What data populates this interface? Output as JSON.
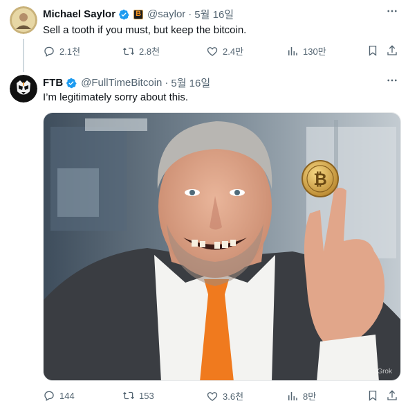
{
  "tweet1": {
    "author_name": "Michael Saylor",
    "affiliate_badge": "B",
    "handle": "@saylor",
    "separator": "·",
    "date": "5월 16일",
    "text": "Sell a tooth if you must, but keep the bitcoin.",
    "replies": "2.1천",
    "retweets": "2.8천",
    "likes": "2.4만",
    "views": "130만"
  },
  "tweet2": {
    "author_name": "FTB",
    "handle": "@FullTimeBitcoin",
    "separator": "·",
    "date": "5월 16일",
    "text": "I’m legitimately sorry about this.",
    "image_watermark": "Grok",
    "replies": "144",
    "retweets": "153",
    "likes": "3.6천",
    "views": "8만"
  },
  "icons": {
    "more": "more-icon",
    "reply": "reply-icon",
    "retweet": "retweet-icon",
    "like": "heart-icon",
    "views": "views-icon",
    "bookmark": "bookmark-icon",
    "share": "share-icon",
    "verified": "verified-badge-icon"
  },
  "colors": {
    "verified_blue": "#1d9bf0",
    "muted_text": "#536471",
    "bitcoin_orange": "#f7931a"
  }
}
